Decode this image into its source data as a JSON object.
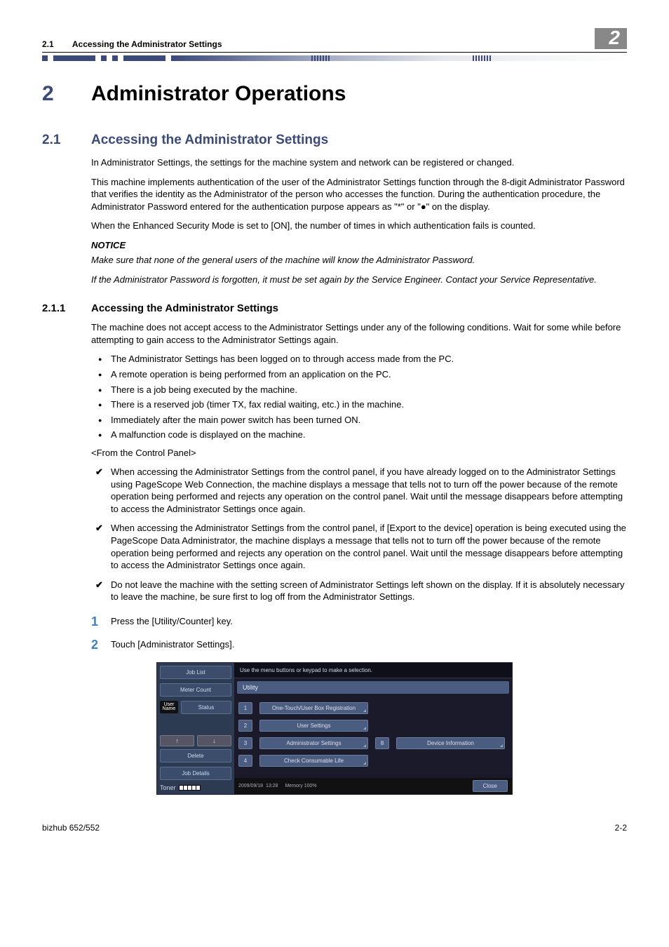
{
  "header": {
    "section_num": "2.1",
    "section_title": "Accessing the Administrator Settings",
    "chapter_badge": "2"
  },
  "chapter": {
    "num": "2",
    "title": "Administrator Operations"
  },
  "s21": {
    "num": "2.1",
    "title": "Accessing the Administrator Settings",
    "p1": "In Administrator Settings, the settings for the machine system and network can be registered or changed.",
    "p2": "This machine implements authentication of the user of the Administrator Settings function through the 8-digit Administrator Password that verifies the identity as the Administrator of the person who accesses the function. During the authentication procedure, the Administrator Password entered for the authentication purpose appears as \"*\" or \"●\" on the display.",
    "p3": "When the Enhanced Security Mode is set to [ON], the number of times in which authentication fails is counted.",
    "notice_head": "NOTICE",
    "notice1": "Make sure that none of the general users of the machine will know the Administrator Password.",
    "notice2": "If the Administrator Password is forgotten, it must be set again by the Service Engineer. Contact your Service Representative."
  },
  "s211": {
    "num": "2.1.1",
    "title": "Accessing the Administrator Settings",
    "intro": "The machine does not accept access to the Administrator Settings under any of the following conditions. Wait for some while before attempting to gain access to the Administrator Settings again.",
    "bullets": [
      "The Administrator Settings has been logged on to through access made from the PC.",
      "A remote operation is being performed from an application on the PC.",
      "There is a job being executed by the machine.",
      "There is a reserved job (timer TX, fax redial waiting, etc.) in the machine.",
      "Immediately after the main power switch has been turned ON.",
      "A malfunction code is displayed on the machine."
    ],
    "from_panel": "<From the Control Panel>",
    "checks": [
      "When accessing the Administrator Settings from the control panel, if you have already logged on to the Administrator Settings using PageScope Web Connection, the machine displays a message that tells not to turn off the power because of the remote operation being performed and rejects any operation on the control panel. Wait until the message disappears before attempting to access the Administrator Settings once again.",
      "When accessing the Administrator Settings from the control panel, if [Export to the device] operation is being executed using the PageScope Data Administrator, the machine displays a message that tells not to turn off the power because of the remote operation being performed and rejects any operation on the control panel. Wait until the message disappears before attempting to access the Administrator Settings once again.",
      "Do not leave the machine with the setting screen of Administrator Settings left shown on the display. If it is absolutely necessary to leave the machine, be sure first to log off from the Administrator Settings."
    ],
    "steps": [
      "Press the [Utility/Counter] key.",
      "Touch [Administrator Settings]."
    ]
  },
  "panel": {
    "prompt": "Use the menu buttons or keypad to make a selection.",
    "utility": "Utility",
    "left": {
      "job_list": "Job List",
      "meter_count": "Meter Count",
      "user_name": "User Name",
      "status": "Status",
      "up": "↑",
      "down": "↓",
      "delete": "Delete",
      "job_details": "Job Details",
      "toner": "Toner"
    },
    "menu": {
      "n1": "1",
      "m1": "One-Touch/User Box Registration",
      "n2": "2",
      "m2": "User Settings",
      "n3": "3",
      "m3": "Administrator Settings",
      "n4": "4",
      "m4": "Check Consumable Life",
      "n8": "8",
      "m8": "Device Information"
    },
    "foot": {
      "date": "2009/09/18",
      "time": "13:28",
      "memory_label": "Memory",
      "memory": "100%",
      "close": "Close"
    }
  },
  "footer": {
    "left": "bizhub 652/552",
    "right": "2-2"
  }
}
